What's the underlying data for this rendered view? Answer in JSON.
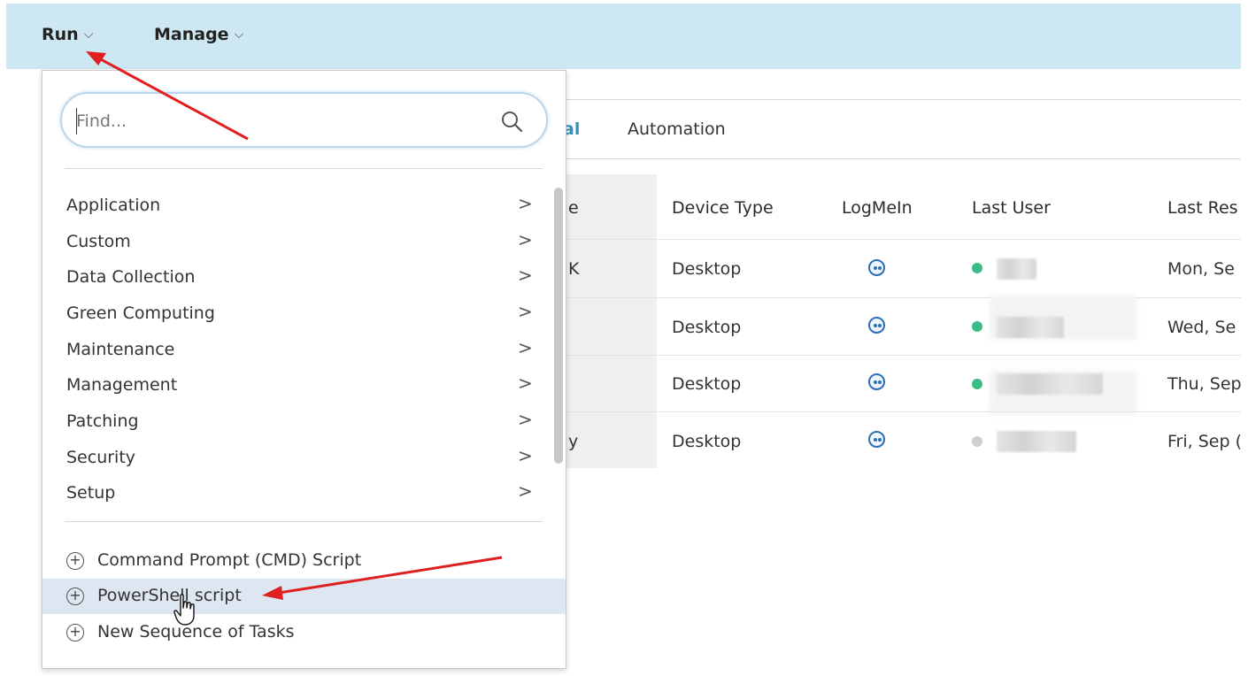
{
  "topbar": {
    "run_label": "Run",
    "manage_label": "Manage",
    "chevron": "⌵"
  },
  "tabs": [
    {
      "label": "al"
    },
    {
      "label": "Automation"
    }
  ],
  "table": {
    "headers": [
      "e",
      "Device Type",
      "LogMeIn",
      "Last User",
      "Last Res"
    ],
    "rows": [
      {
        "name_fragment": "K",
        "device_type": "Desktop",
        "status_color": "#3dbb87",
        "last_res": "Mon, Se"
      },
      {
        "name_fragment": "",
        "device_type": "Desktop",
        "status_color": "#3dbb87",
        "last_res": "Wed, Se"
      },
      {
        "name_fragment": "",
        "device_type": "Desktop",
        "status_color": "#3dbb87",
        "last_res": "Thu, Sep"
      },
      {
        "name_fragment": "y",
        "device_type": "Desktop",
        "status_color": "#cfcfcf",
        "last_res": "Fri, Sep ("
      }
    ]
  },
  "dropdown": {
    "search_placeholder": "Find...",
    "categories": [
      {
        "label": "Application"
      },
      {
        "label": "Custom"
      },
      {
        "label": "Data Collection"
      },
      {
        "label": "Green Computing"
      },
      {
        "label": "Maintenance"
      },
      {
        "label": "Management"
      },
      {
        "label": "Patching"
      },
      {
        "label": "Security"
      },
      {
        "label": "Setup"
      }
    ],
    "arrow_glyph": ">",
    "plus_glyph": "+",
    "actions": [
      {
        "label": "Command Prompt (CMD) Script"
      },
      {
        "label": "PowerShell script"
      },
      {
        "label": "New Sequence of Tasks"
      }
    ]
  },
  "colors": {
    "topbar": "#cde8f2",
    "highlight": "#dde6f1",
    "annotation_arrow": "#e02020",
    "logmein_icon": "#2c6fb4"
  },
  "icons": {
    "search": "search-icon",
    "logmein": "logmein-icon",
    "chevron": "chevron-down-icon",
    "category_arrow": "chevron-right-icon",
    "add": "plus-circle-icon",
    "cursor": "hand-cursor-icon"
  }
}
